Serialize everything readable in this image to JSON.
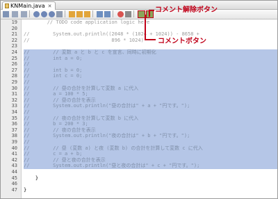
{
  "tab": {
    "label": "KNMain.java"
  },
  "callouts": {
    "uncomment": "コメント解除ボタン",
    "comment": "コメントボタン"
  },
  "lines": [
    {
      "n": "19",
      "code": "        // TODO code application logic here",
      "sel": false
    },
    {
      "n": "20",
      "code": "",
      "sel": false
    },
    {
      "n": "21",
      "code": "//        System.out.println((2048 * (1024 + 1024)) - 8658 +",
      "sel": false
    },
    {
      "n": "22",
      "code": "//                            896 * 1024)",
      "sel": false
    },
    {
      "n": "23",
      "code": "",
      "sel": false
    },
    {
      "n": "24",
      "code": "//        // 変数 a と b と c を宣言、同時に初期化",
      "sel": true
    },
    {
      "n": "25",
      "code": "//        int a = 0;",
      "sel": true
    },
    {
      "n": "26",
      "code": "//",
      "sel": true
    },
    {
      "n": "27",
      "code": "//        int b = 0;",
      "sel": true
    },
    {
      "n": "28",
      "code": "//        int c = 0;",
      "sel": true
    },
    {
      "n": "29",
      "code": "//",
      "sel": true
    },
    {
      "n": "30",
      "code": "//        // 昼の合計を計算して変数 a に代入",
      "sel": true
    },
    {
      "n": "31",
      "code": "//        a = 100 * 5;",
      "sel": true
    },
    {
      "n": "32",
      "code": "//        // 昼の合計を表示",
      "sel": true
    },
    {
      "n": "33",
      "code": "//        System.out.println(\"昼の合計は\" + a + \"円です。\");",
      "sel": true
    },
    {
      "n": "34",
      "code": "//",
      "sel": true
    },
    {
      "n": "35",
      "code": "//        // 夜の合計を計算して変数 b に代入",
      "sel": true
    },
    {
      "n": "36",
      "code": "//        b = 200 * 3;",
      "sel": true
    },
    {
      "n": "37",
      "code": "//        // 夜の合計を表示",
      "sel": true
    },
    {
      "n": "38",
      "code": "//        System.out.println(\"夜の合計は\" + b + \"円です。\");",
      "sel": true
    },
    {
      "n": "39",
      "code": "//",
      "sel": true
    },
    {
      "n": "40",
      "code": "//        // 昼 (変数 a) と夜 (変数 b) の合計を計算して変数 c に代入",
      "sel": true
    },
    {
      "n": "41",
      "code": "//        c = a + b;",
      "sel": true
    },
    {
      "n": "42",
      "code": "//        // 昼と夜の合計を表示",
      "sel": true
    },
    {
      "n": "43",
      "code": "//        System.out.println(\"昼と夜の合計は\" + c + \"円です。\");",
      "sel": true
    },
    {
      "n": "44",
      "code": "",
      "sel": false
    },
    {
      "n": "45",
      "code": "    }",
      "sel": false
    },
    {
      "n": "46",
      "code": "",
      "sel": false
    },
    {
      "n": "47",
      "code": "}",
      "sel": false
    }
  ],
  "colors": {
    "selection": "#b5c6e7",
    "callout": "#c00018"
  }
}
